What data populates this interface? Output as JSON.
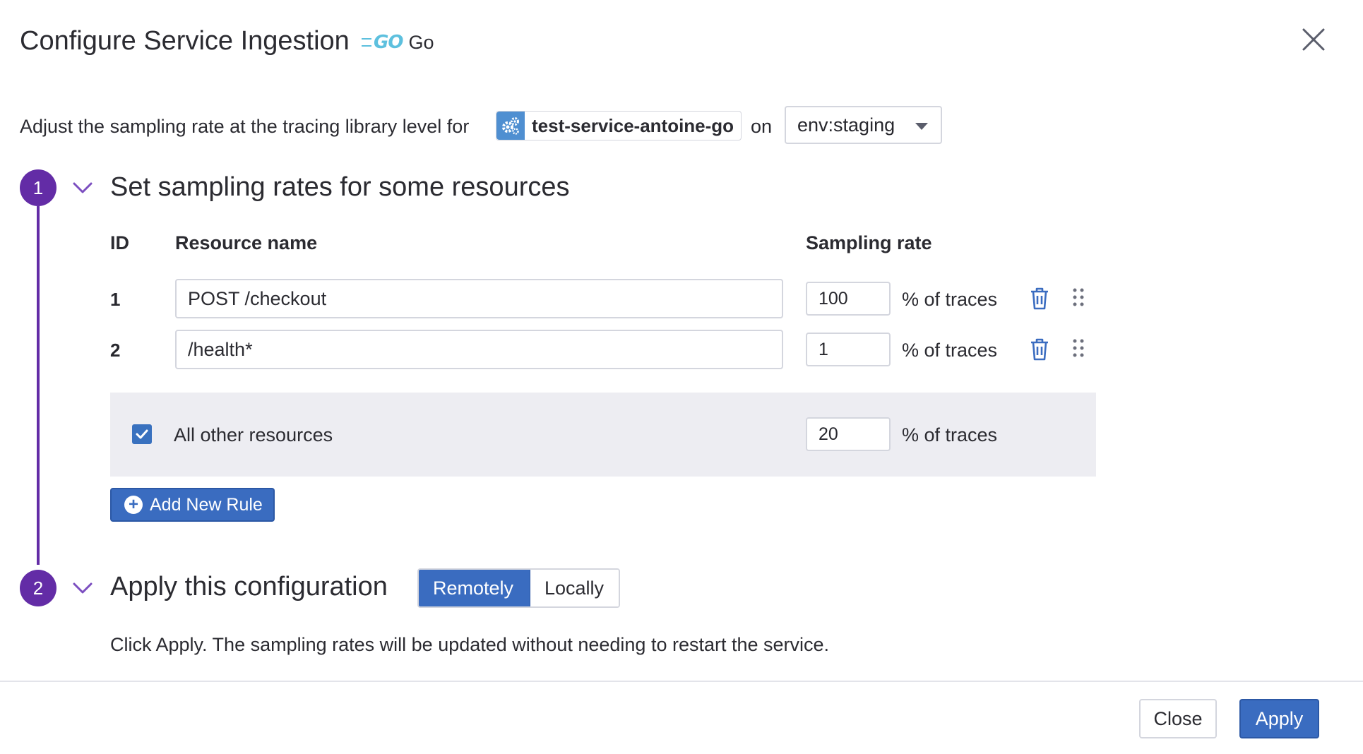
{
  "modal": {
    "title": "Configure Service Ingestion",
    "language_logo": "GO",
    "language": "Go"
  },
  "description": {
    "prefix": "Adjust the sampling rate at the tracing library level for",
    "service_icon": "gears-icon",
    "service_name": "test-service-antoine-go",
    "on_label": "on",
    "env_selected": "env:staging"
  },
  "step1": {
    "number": "1",
    "title": "Set sampling rates for some resources",
    "headers": {
      "id": "ID",
      "resource": "Resource name",
      "rate": "Sampling rate"
    },
    "rows": [
      {
        "id": "1",
        "resource": "POST /checkout",
        "rate": "100",
        "unit": "% of traces"
      },
      {
        "id": "2",
        "resource": "/health*",
        "rate": "1",
        "unit": "% of traces"
      }
    ],
    "other": {
      "checked": true,
      "label": "All other resources",
      "rate": "20",
      "unit": "% of traces"
    },
    "add_rule": "Add New Rule"
  },
  "step2": {
    "number": "2",
    "title": "Apply this configuration",
    "options": [
      "Remotely",
      "Locally"
    ],
    "selected": "Remotely",
    "note": "Click Apply. The sampling rates will be updated without needing to restart the service."
  },
  "footer": {
    "close": "Close",
    "apply": "Apply"
  },
  "colors": {
    "accent": "#3a6cc0",
    "step": "#632ca6",
    "go": "#5dc0de",
    "service_icon_bg": "#4f8fd1"
  }
}
